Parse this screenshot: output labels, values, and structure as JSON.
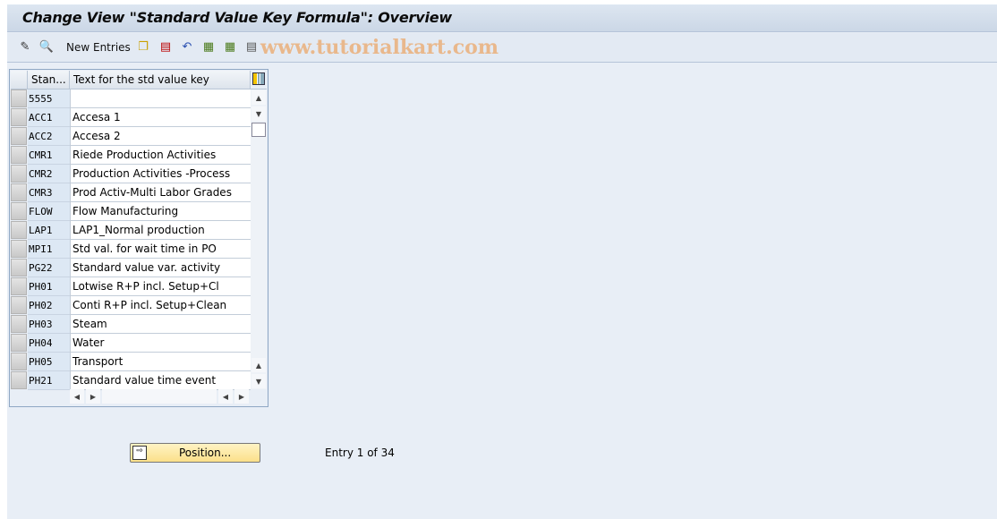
{
  "window": {
    "title": "Change View \"Standard Value Key Formula\": Overview"
  },
  "toolbar": {
    "new_entries_label": "New Entries",
    "watermark": "www.tutorialkart.com",
    "icons": [
      "display-change-icon",
      "inspect-icon",
      "copy-icon",
      "delete-icon",
      "undo-icon",
      "select-all-icon",
      "select-block-icon",
      "deselect-all-icon"
    ]
  },
  "table": {
    "columns": [
      "Stan...",
      "Text for the std value key"
    ],
    "rows": [
      {
        "key": "5555",
        "text": ""
      },
      {
        "key": "ACC1",
        "text": "Accesa 1"
      },
      {
        "key": "ACC2",
        "text": "Accesa 2"
      },
      {
        "key": "CMR1",
        "text": "Riede Production Activities"
      },
      {
        "key": "CMR2",
        "text": "Production Activities -Process"
      },
      {
        "key": "CMR3",
        "text": "Prod Activ-Multi Labor Grades"
      },
      {
        "key": "FLOW",
        "text": "Flow Manufacturing"
      },
      {
        "key": "LAP1",
        "text": "LAP1_Normal production"
      },
      {
        "key": "MPI1",
        "text": "Std val. for wait time in PO"
      },
      {
        "key": "PG22",
        "text": "Standard value var. activity"
      },
      {
        "key": "PH01",
        "text": "Lotwise R+P incl. Setup+Cl"
      },
      {
        "key": "PH02",
        "text": "Conti R+P incl. Setup+Clean"
      },
      {
        "key": "PH03",
        "text": "Steam"
      },
      {
        "key": "PH04",
        "text": "Water"
      },
      {
        "key": "PH05",
        "text": "Transport"
      },
      {
        "key": "PH21",
        "text": "Standard value time event"
      }
    ]
  },
  "footer": {
    "position_label": "Position...",
    "entry_text": "Entry 1 of 34"
  }
}
